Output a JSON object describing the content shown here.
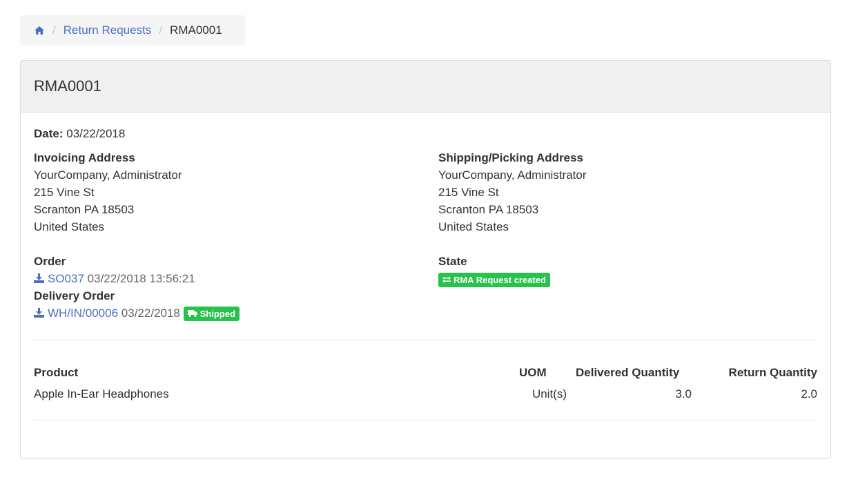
{
  "breadcrumb": {
    "home_icon": "home-icon",
    "separator": "/",
    "items": [
      "Return Requests",
      "RMA0001"
    ]
  },
  "panel": {
    "title": "RMA0001",
    "date_label": "Date:",
    "date_value": "03/22/2018",
    "invoicing": {
      "heading": "Invoicing Address",
      "lines": [
        "YourCompany, Administrator",
        "215 Vine St",
        "Scranton PA 18503",
        "United States"
      ]
    },
    "shipping": {
      "heading": "Shipping/Picking Address",
      "lines": [
        "YourCompany, Administrator",
        "215 Vine St",
        "Scranton PA 18503",
        "United States"
      ]
    },
    "order": {
      "heading": "Order",
      "ref": "SO037",
      "datetime": "03/22/2018 13:56:21"
    },
    "delivery": {
      "heading": "Delivery Order",
      "ref": "WH/IN/00006",
      "date": "03/22/2018",
      "badge": "Shipped",
      "badge_icon": "truck-icon"
    },
    "state": {
      "heading": "State",
      "badge": "RMA Request created",
      "badge_icon": "exchange-icon"
    },
    "table": {
      "headers": [
        "Product",
        "UOM",
        "Delivered Quantity",
        "Return Quantity"
      ],
      "rows": [
        [
          "Apple In-Ear Headphones",
          "Unit(s)",
          "3.0",
          "2.0"
        ]
      ]
    }
  },
  "colors": {
    "link": "#4a6fc0",
    "badge_green": "#27c24c",
    "heading_bg": "#f0f0f0",
    "breadcrumb_bg": "#f5f5f5"
  }
}
